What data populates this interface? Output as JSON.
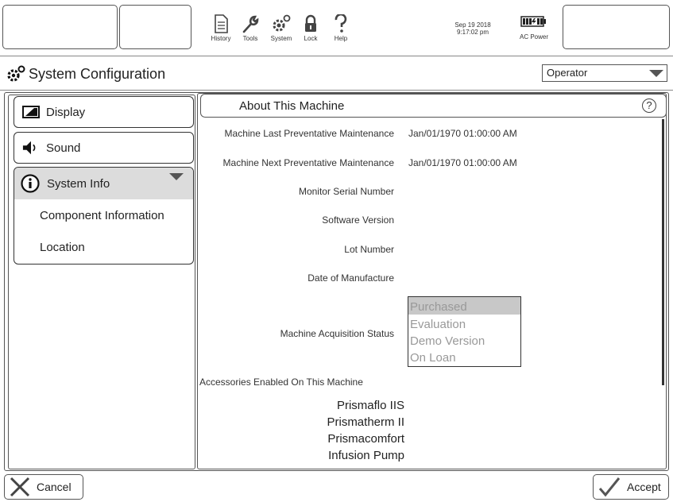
{
  "toolbar": {
    "history_label": "History",
    "tools_label": "Tools",
    "system_label": "System",
    "lock_label": "Lock",
    "help_label": "Help",
    "date": "Sep 19 2018",
    "time": "9:17:02 pm",
    "power_label": "AC Power"
  },
  "header": {
    "title": "System Configuration",
    "role_selected": "Operator"
  },
  "sidebar": {
    "display_label": "Display",
    "sound_label": "Sound",
    "system_info_label": "System Info",
    "sub_items": [
      "Component Information",
      "Location"
    ]
  },
  "content": {
    "title": "About This Machine",
    "help_glyph": "?",
    "fields": [
      {
        "label": "Machine Last Preventative Maintenance",
        "value": "Jan/01/1970 01:00:00 AM"
      },
      {
        "label": "Machine Next Preventative Maintenance",
        "value": "Jan/01/1970 01:00:00 AM"
      },
      {
        "label": "Monitor Serial Number",
        "value": ""
      },
      {
        "label": "Software Version",
        "value": ""
      },
      {
        "label": "Lot Number",
        "value": ""
      },
      {
        "label": "Date of Manufacture",
        "value": ""
      }
    ],
    "acquisition_label": "Machine Acquisition Status",
    "acquisition_options": [
      "Purchased",
      "Evaluation",
      "Demo Version",
      "On Loan"
    ],
    "acquisition_selected": "Purchased",
    "accessories_header": "Accessories Enabled On This Machine",
    "accessories": [
      "Prismaflo IIS",
      "Prismatherm II",
      "Prismacomfort",
      "Infusion Pump"
    ]
  },
  "footer": {
    "cancel_label": "Cancel",
    "accept_label": "Accept"
  },
  "colors": {
    "selected_bg": "#dcdcdc",
    "border": "#555555",
    "disabled_text": "#999999"
  }
}
